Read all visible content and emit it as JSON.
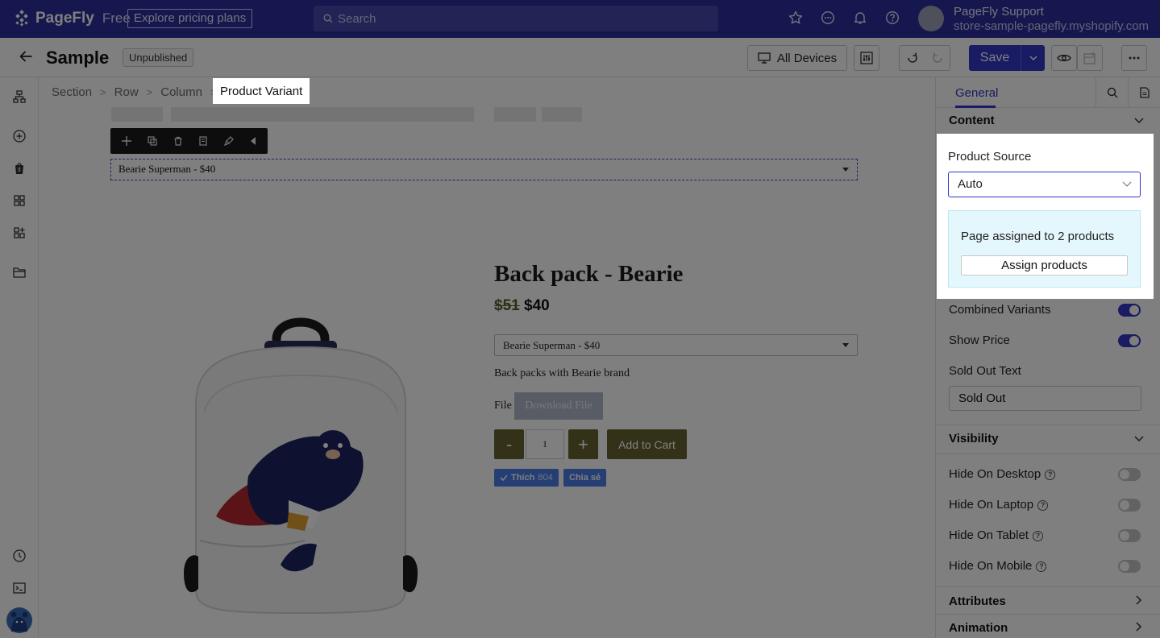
{
  "topbar": {
    "brand": "PageFly",
    "plan": "Free",
    "pricing_link": "Explore pricing plans",
    "search_placeholder": "Search",
    "account_name": "PageFly Support",
    "store": "store-sample-pagefly.myshopify.com"
  },
  "toolbar": {
    "page_title": "Sample",
    "status": "Unpublished",
    "devices": "All Devices",
    "save": "Save"
  },
  "breadcrumb": [
    "Section",
    "Row",
    "Column",
    "Product Variant"
  ],
  "canvas": {
    "selected_variant": "Bearie Superman - $40",
    "product": {
      "title": "Back pack - Bearie",
      "old_price": "$51",
      "price": "$40",
      "variant": "Bearie Superman - $40",
      "description": "Back packs with Bearie brand",
      "file_label": "File",
      "download_label": "Download File",
      "minus": "-",
      "quantity": "1",
      "plus": "+",
      "add_to_cart": "Add to Cart",
      "like_label": "Thích",
      "like_count": "804",
      "share_label": "Chia sẻ"
    }
  },
  "panel": {
    "tab_general": "General",
    "content_heading": "Content",
    "product_source_label": "Product Source",
    "product_source_value": "Auto",
    "assigned_text": "Page assigned to 2 products",
    "assign_button": "Assign products",
    "combined_variants": "Combined Variants",
    "combined_variants_on": true,
    "show_price": "Show Price",
    "show_price_on": true,
    "sold_out_label": "Sold Out Text",
    "sold_out_value": "Sold Out",
    "visibility_heading": "Visibility",
    "hide_desktop": "Hide On Desktop",
    "hide_laptop": "Hide On Laptop",
    "hide_tablet": "Hide On Tablet",
    "hide_mobile": "Hide On Mobile",
    "attributes_heading": "Attributes",
    "animation_heading": "Animation"
  },
  "colors": {
    "brand": "#2c2f9e",
    "accent": "#3236c6",
    "product_button": "#66622e",
    "facebook": "#4a7de8",
    "info_bg": "#e4f7fd"
  }
}
